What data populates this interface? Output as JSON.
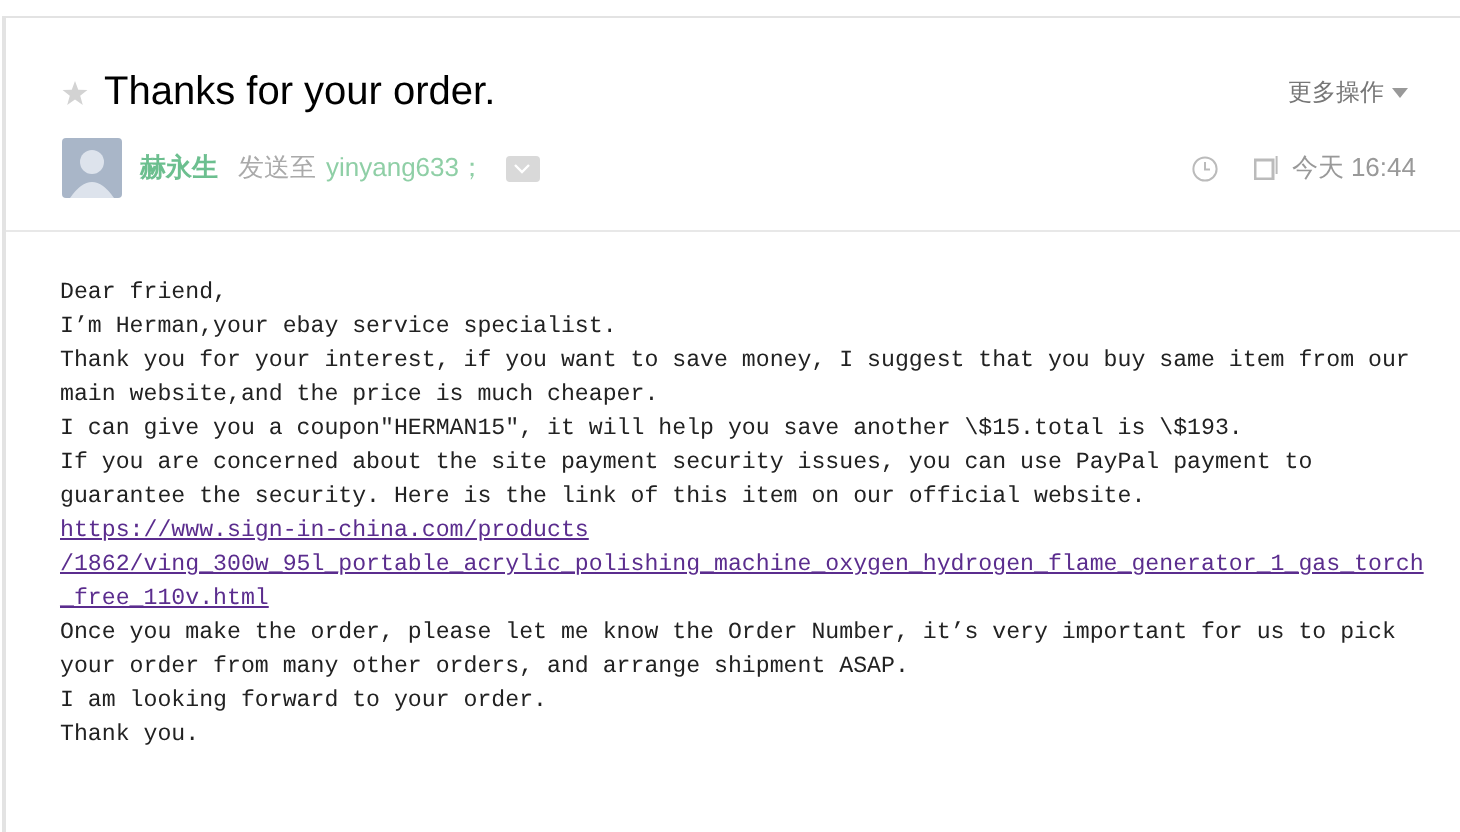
{
  "header": {
    "starred": false,
    "subject": "Thanks for your order.",
    "more_actions": "更多操作",
    "sender": "赫永生",
    "sent_to_label": "发送至",
    "recipient": "yinyang633；",
    "date": "今天 16:44"
  },
  "body": [
    {
      "kind": "text",
      "text": "Dear friend,"
    },
    {
      "kind": "text",
      "text": "I’m Herman,your ebay service specialist."
    },
    {
      "kind": "text",
      "text": "Thank you for your interest, if you want to save money, I suggest that you buy same item from our"
    },
    {
      "kind": "text",
      "text": "main website,and the price is much cheaper."
    },
    {
      "kind": "text",
      "text": "I can give you a coupon″HERMAN15″, it will help you save another \\$15.total is \\$193."
    },
    {
      "kind": "text",
      "text": "If you are concerned about the site payment security issues, you can use PayPal payment to"
    },
    {
      "kind": "text",
      "text": "guarantee the security. Here is the link of this item on our official website."
    },
    {
      "kind": "link",
      "text": "https://www.sign-in-china.com/products"
    },
    {
      "kind": "link",
      "text": "/1862/ving_300w_95l_portable_acrylic_polishing_machine_oxygen_hydrogen_flame_generator_1_gas_torch"
    },
    {
      "kind": "link",
      "text": "_free_110v.html"
    },
    {
      "kind": "text",
      "text": "Once you make the order, please let me know the Order Number, it’s very important for us to pick"
    },
    {
      "kind": "text",
      "text": "your order from many other orders, and arrange shipment ASAP."
    },
    {
      "kind": "text",
      "text": "I am looking forward to your order."
    },
    {
      "kind": "text",
      "text": "Thank you."
    }
  ]
}
